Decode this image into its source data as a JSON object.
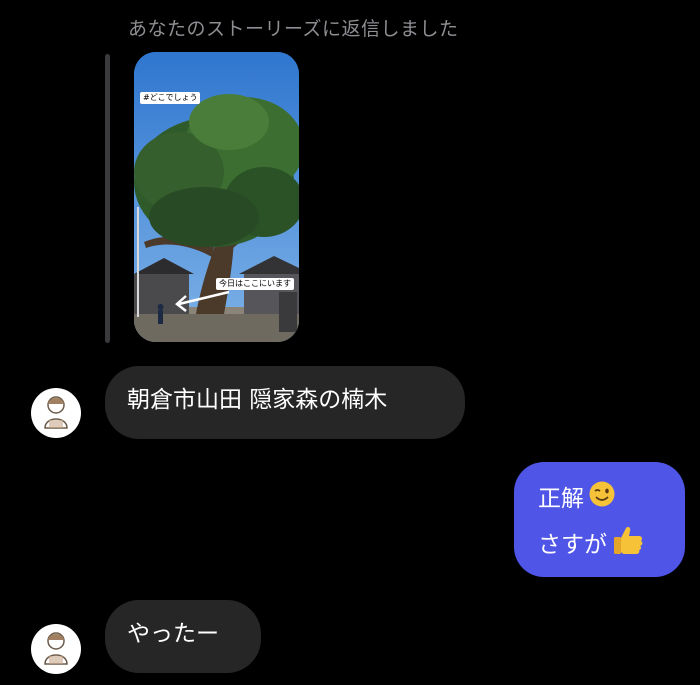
{
  "reply_note": "あなたのストーリーズに返信しました",
  "story": {
    "tag_top": "#どこでしょう",
    "tag_bottom": "今日はここにいます"
  },
  "messages": [
    {
      "from": "them",
      "text": "朝倉市山田 隠家森の楠木"
    },
    {
      "from": "me",
      "line1": "正解",
      "line1_emoji": "winking-face",
      "line2": "さすが",
      "line2_emoji": "thumbs-up"
    },
    {
      "from": "them",
      "text": "やったー"
    }
  ],
  "colors": {
    "background": "#000000",
    "received_bubble": "#262626",
    "sent_bubble": "#4f55e6",
    "meta_text": "#8e8e93"
  }
}
